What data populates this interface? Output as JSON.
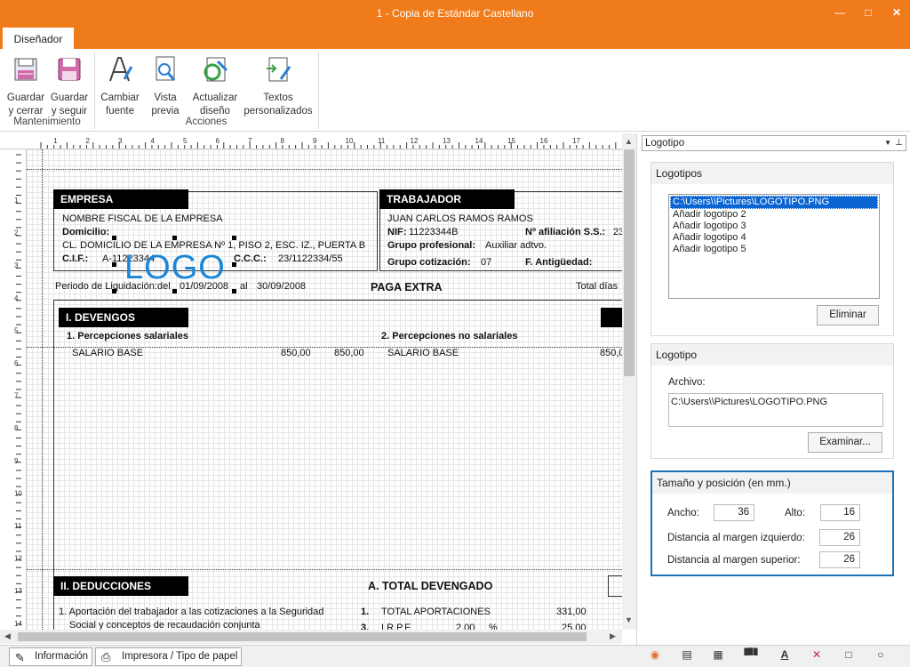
{
  "window": {
    "title": "1 - Copia de Estándar Castellano"
  },
  "ribbon": {
    "tab": "Diseñador",
    "buttons": [
      {
        "label": "Guardar\ny cerrar"
      },
      {
        "label": "Guardar\ny seguir"
      },
      {
        "label": "Cambiar\nfuente"
      },
      {
        "label": "Vista\nprevia"
      },
      {
        "label": "Actualizar\ndiseño"
      },
      {
        "label": "Textos\npersonalizados"
      }
    ],
    "groups": {
      "g1": "Mantenimiento",
      "g2": "Acciones"
    }
  },
  "ruler": {
    "marks": [
      "1",
      "2",
      "3",
      "4",
      "5",
      "6",
      "7",
      "8",
      "9",
      "10",
      "11",
      "12",
      "13",
      "14",
      "15",
      "16",
      "17"
    ],
    "vmarks": [
      "1",
      "2",
      "3",
      "4",
      "5",
      "6",
      "7",
      "8",
      "9",
      "10",
      "11",
      "12",
      "13",
      "14"
    ]
  },
  "report": {
    "empresa": {
      "title": "EMPRESA",
      "name": "NOMBRE FISCAL DE LA EMPRESA",
      "domicilio_label": "Domicilio:",
      "domicilio": "CL. DOMICILIO DE LA EMPRESA Nº 1, PISO 2, ESC. IZ., PUERTA B",
      "cif_label": "C.I.F.:",
      "cif": "A-11223344",
      "ccc_label": "C.C.C.:",
      "ccc": "23/1122334/55"
    },
    "logo": "LOGO",
    "trabajador": {
      "title": "TRABAJADOR",
      "name": "JUAN CARLOS RAMOS RAMOS",
      "nif_label": "NIF:",
      "nif": "11223344B",
      "afil_label": "Nº afiliación S.S.:",
      "afil": "23",
      "grupo_label": "Grupo profesional:",
      "grupo": "Auxiliar adtvo.",
      "cot_label": "Grupo cotización:",
      "cot": "07",
      "antig_label": "F. Antigüedad:"
    },
    "periodo": {
      "label": "Periodo de Liquidación:del",
      "from": "01/09/2008",
      "al": "al",
      "to": "30/09/2008",
      "title": "PAGA EXTRA",
      "dias": "Total días"
    },
    "devengos": {
      "title": "I. DEVENGOS",
      "perc_sal": "1. Percepciones salariales",
      "perc_no": "2. Percepciones no salariales",
      "row_label": "SALARIO BASE",
      "v1": "850,00",
      "v2": "850,00",
      "row2_label": "SALARIO BASE",
      "v3": "850,0"
    },
    "deducciones": {
      "title": "II. DEDUCCIONES",
      "total_dev": "A. TOTAL DEVENGADO",
      "item1": "1. Aportación del trabajador a las cotizaciones a la Seguridad",
      "item1b": "Social y conceptos de recaudación conjunta",
      "n1": "1.",
      "tot_ap": "TOTAL APORTACIONES",
      "tot_ap_val": "331,00",
      "n3": "3.",
      "irpf": "I.R.P.F.",
      "irpf_pct": "2,00",
      "pct": "%",
      "irpf_val": "25,00"
    }
  },
  "panel": {
    "combo": "Logotipo",
    "logotipos": {
      "header": "Logotipos",
      "items": [
        "C:\\Users\\\\Pictures\\LOGOTIPO.PNG",
        "Añadir logotipo 2",
        "Añadir logotipo 3",
        "Añadir logotipo 4",
        "Añadir logotipo 5"
      ],
      "eliminar": "Eliminar"
    },
    "logotipo": {
      "header": "Logotipo",
      "archivo_label": "Archivo:",
      "archivo": "C:\\Users\\\\Pictures\\LOGOTIPO.PNG",
      "examinar": "Examinar..."
    },
    "tamano": {
      "header": "Tamaño y posición (en mm.)",
      "ancho_label": "Ancho:",
      "ancho": "36",
      "alto_label": "Alto:",
      "alto": "16",
      "izq_label": "Distancia al margen izquierdo:",
      "izq": "26",
      "sup_label": "Distancia al margen superior:",
      "sup": "26"
    }
  },
  "status": {
    "tab1": "Información",
    "tab2": "Impresora / Tipo de papel"
  },
  "colors": {
    "accent": "#ef7b1a",
    "logo": "#1a86d6",
    "highlight": "#0a64d2"
  }
}
